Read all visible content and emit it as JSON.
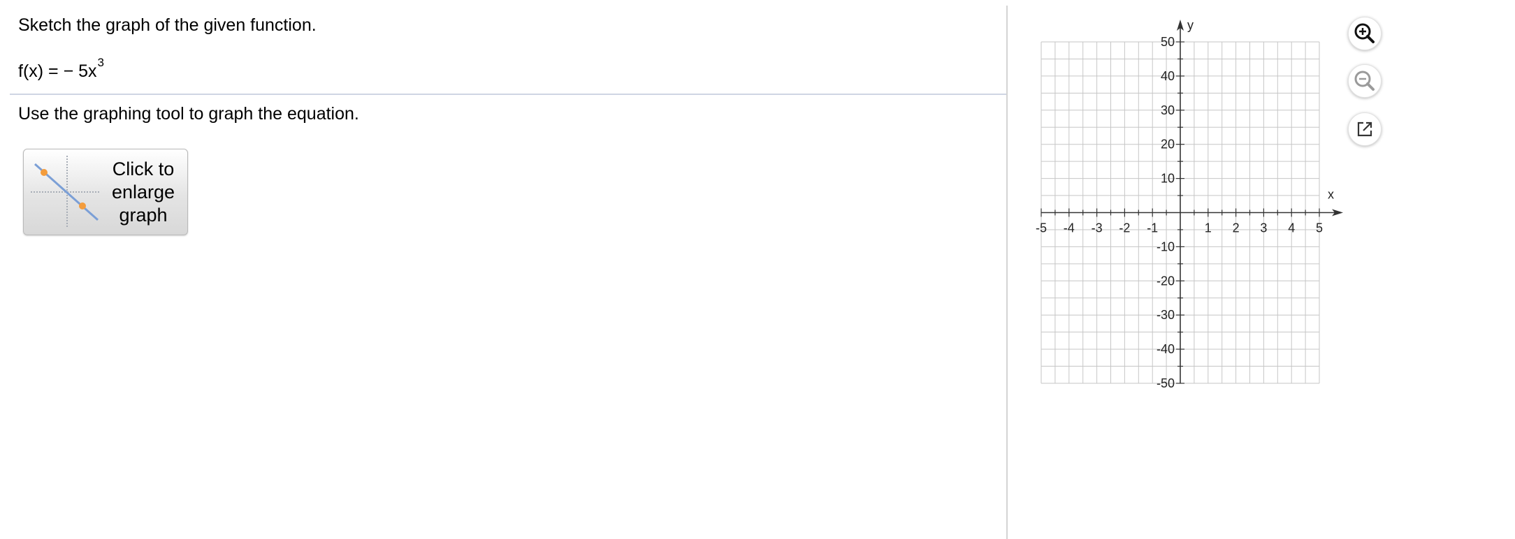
{
  "question": {
    "instruction": "Sketch the graph of the given function.",
    "function_lhs": "f(x) = − 5x",
    "function_exponent": "3",
    "tool_instruction": "Use the graphing tool to graph the equation."
  },
  "enlarge_button": {
    "line1": "Click to",
    "line2": "enlarge",
    "line3": "graph"
  },
  "graph": {
    "x_axis_label": "x",
    "y_axis_label": "y",
    "x_tick_labels": [
      "-5",
      "-4",
      "-3",
      "-2",
      "-1",
      "1",
      "2",
      "3",
      "4",
      "5"
    ],
    "y_tick_labels": [
      "50",
      "40",
      "30",
      "20",
      "10",
      "-10",
      "-20",
      "-30",
      "-40",
      "-50"
    ]
  },
  "chart_data": {
    "type": "scatter",
    "x": [],
    "y": [],
    "xlim": [
      -5,
      5
    ],
    "ylim": [
      -50,
      50
    ],
    "x_ticks": [
      -5,
      -4,
      -3,
      -2,
      -1,
      1,
      2,
      3,
      4,
      5
    ],
    "y_ticks": [
      -50,
      -40,
      -30,
      -20,
      -10,
      10,
      20,
      30,
      40,
      50
    ],
    "grid": true,
    "xlabel": "x",
    "ylabel": "y"
  },
  "toolbar": {
    "zoom_in_icon": "zoom-in-icon",
    "zoom_out_icon": "zoom-out-icon",
    "popout_icon": "popout-icon"
  },
  "colors": {
    "grid_line": "#c6c6c6",
    "axis": "#333333",
    "divider": "#d4d4d4",
    "thumb_line": "#7b9fd6",
    "thumb_point": "#f39c3c"
  }
}
